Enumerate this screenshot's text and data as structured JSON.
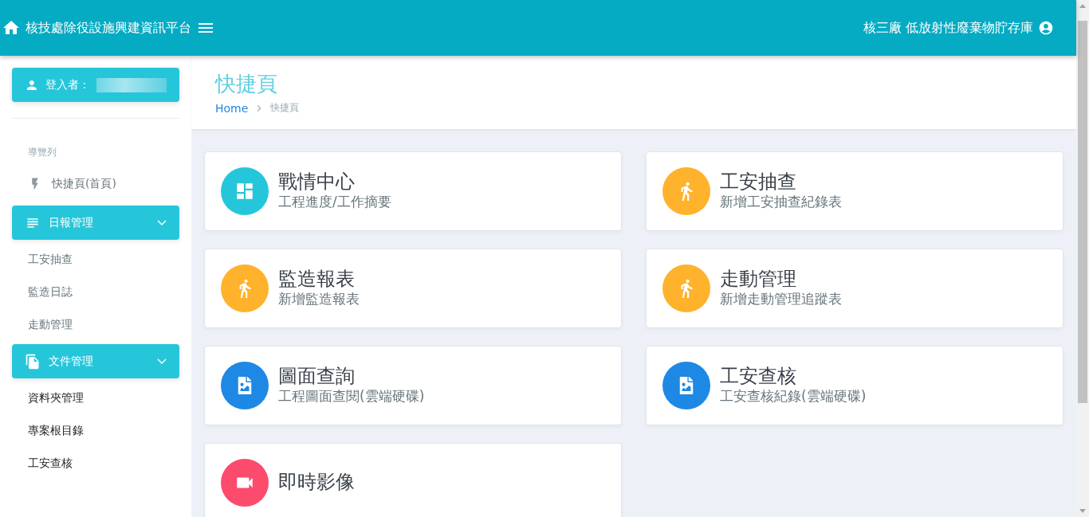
{
  "header": {
    "title": "核技處除役設施興建資訊平台",
    "site": "核三廠 低放射性廢棄物貯存庫"
  },
  "sidebar": {
    "user_label": "登入者：",
    "items": [
      {
        "kind": "label",
        "label": "導覽列"
      },
      {
        "kind": "link",
        "label": "快捷頁(首頁)"
      },
      {
        "kind": "group",
        "label": "日報管理",
        "expanded": true,
        "children": [
          {
            "label": "工安抽查"
          },
          {
            "label": "監造日誌"
          },
          {
            "label": "走動管理"
          }
        ]
      },
      {
        "kind": "group",
        "label": "文件管理",
        "expanded": true,
        "children": [
          {
            "label": "資料夾管理"
          },
          {
            "label": "專案根目錄"
          },
          {
            "label": "工安查核"
          }
        ]
      }
    ]
  },
  "page": {
    "title": "快捷頁",
    "breadcrumb": [
      {
        "label": "Home"
      },
      {
        "label": "快捷頁"
      }
    ]
  },
  "cards": [
    {
      "title": "戰情中心",
      "subtitle": "工程進度/工作摘要",
      "kind": "dashboard",
      "color": "#26c6da"
    },
    {
      "title": "工安抽查",
      "subtitle": "新增工安抽查紀錄表",
      "kind": "walk",
      "color": "#ffb22b"
    },
    {
      "title": "監造報表",
      "subtitle": "新增監造報表",
      "kind": "walk",
      "color": "#ffb22b"
    },
    {
      "title": "走動管理",
      "subtitle": "新增走動管理追蹤表",
      "kind": "walk",
      "color": "#ffb22b"
    },
    {
      "title": "圖面查詢",
      "subtitle": "工程圖面查閱(雲端硬碟)",
      "kind": "image",
      "color": "#1e88e5"
    },
    {
      "title": "工安查核",
      "subtitle": "工安查核紀錄(雲端硬碟)",
      "kind": "image",
      "color": "#1e88e5"
    },
    {
      "title": "即時影像",
      "kind": "camera",
      "color": "#fc4b6c"
    }
  ]
}
